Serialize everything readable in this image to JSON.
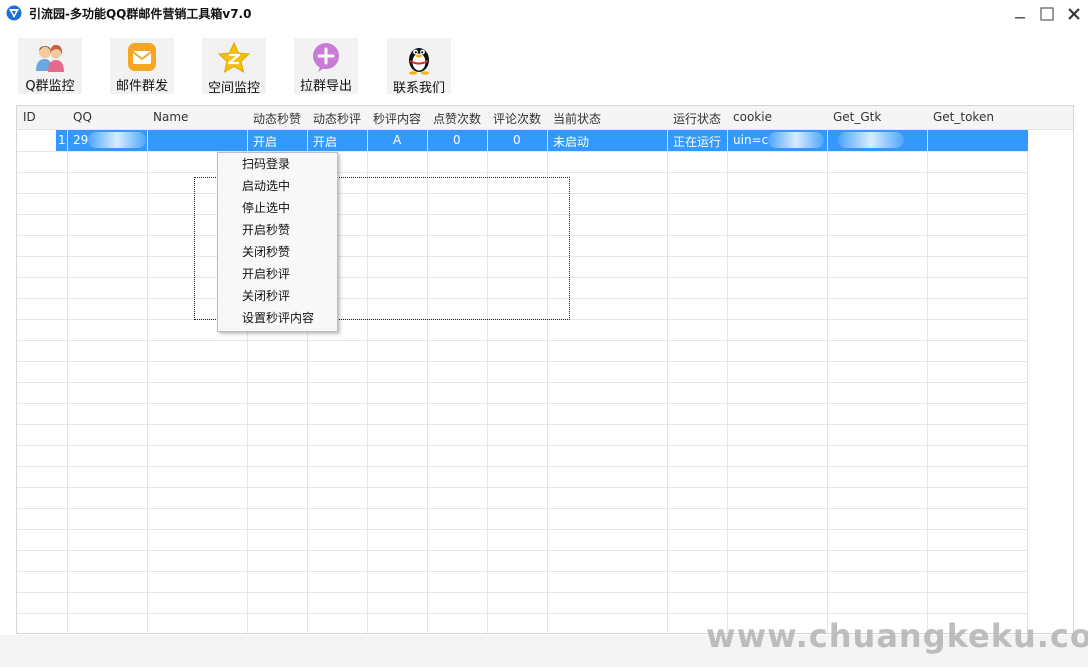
{
  "window": {
    "title": "引流园-多功能QQ群邮件营销工具箱v7.0",
    "minimize_symbol": "—",
    "maximize_symbol": "☐",
    "close_symbol": "✕"
  },
  "toolbar": {
    "buttons": [
      {
        "label": "Q群监控",
        "icon": "users-icon"
      },
      {
        "label": "邮件群发",
        "icon": "mail-icon"
      },
      {
        "label": "空间监控",
        "icon": "star-icon"
      },
      {
        "label": "拉群导出",
        "icon": "plus-circle-icon"
      },
      {
        "label": "联系我们",
        "icon": "qq-penguin-icon"
      }
    ]
  },
  "grid": {
    "columns": [
      "ID",
      "QQ",
      "Name",
      "动态秒赞",
      "动态秒评",
      "秒评内容",
      "点赞次数",
      "评论次数",
      "当前状态",
      "运行状态",
      "cookie",
      "Get_Gtk",
      "Get_token"
    ],
    "rows": [
      {
        "id": "1",
        "qq": "29",
        "name": "",
        "dynamic_like": "开启",
        "dynamic_comment": "开启",
        "comment_content": "A",
        "like_count": "0",
        "comment_count": "0",
        "current_status": "未启动",
        "run_status": "正在运行",
        "cookie": "uin=c",
        "gtk": "",
        "token": ""
      }
    ]
  },
  "context_menu": {
    "items": [
      "扫码登录",
      "启动选中",
      "停止选中",
      "开启秒赞",
      "关闭秒赞",
      "开启秒评",
      "关闭秒评",
      "设置秒评内容"
    ]
  },
  "watermark": "www.chuangkeku.com",
  "colors": {
    "selection": "#3399ff",
    "grid_line": "#e6e6e6",
    "toolbar_button_bg": "#f2f2f2"
  }
}
